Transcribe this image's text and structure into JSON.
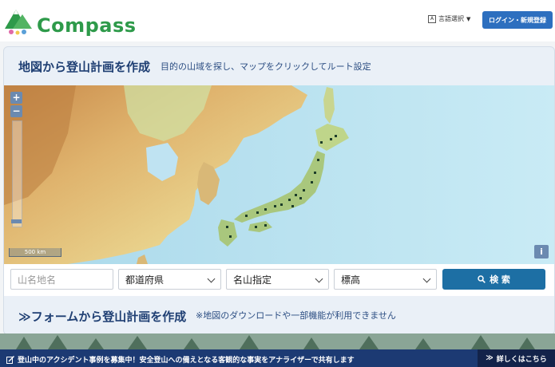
{
  "header": {
    "logo_text": "Compass",
    "language_label": "言語選択",
    "login_label": "ログイン・新規登録"
  },
  "planner": {
    "title": "地図から登山計画を作成",
    "subtitle": "目的の山域を探し、マップをクリックしてルート設定"
  },
  "map": {
    "zoom_in": "+",
    "zoom_out": "−",
    "scale_label": "500 km",
    "info_label": "i"
  },
  "search": {
    "mountain_placeholder": "山名地名",
    "prefecture_label": "都道府県",
    "famous_label": "名山指定",
    "altitude_label": "標高",
    "search_label": "検 索"
  },
  "form_link": {
    "label": "フォームから登山計画を作成",
    "note": "※地図のダウンロードや一部機能が利用できません"
  },
  "banner": {
    "text": "登山中のアクシデント事例を募集中！安全登山への備えとなる客観的な事実をアナライザーで共有します",
    "button_label": "詳しくはこちら"
  },
  "colors": {
    "brand_green": "#2e9a4a",
    "primary_blue": "#2d6fbf",
    "navy": "#1c3a73",
    "search_button": "#1d6fa4"
  }
}
